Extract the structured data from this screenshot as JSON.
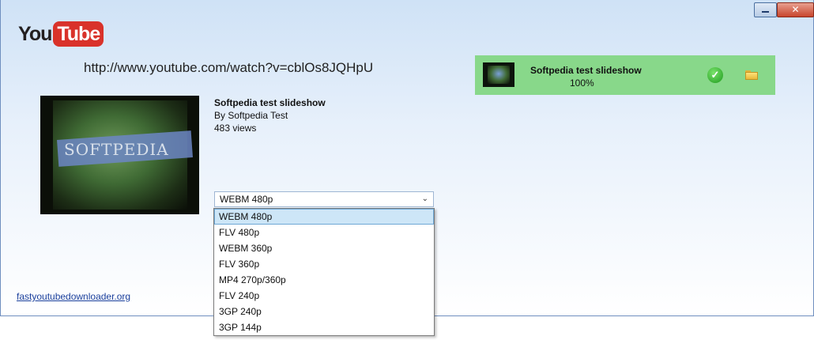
{
  "window": {
    "minimize_icon": "minimize-icon",
    "close_icon": "close-icon",
    "close_label": "✕"
  },
  "logo": {
    "you": "You",
    "tube": "Tube"
  },
  "url": "http://www.youtube.com/watch?v=cblOs8JQHpU",
  "video": {
    "title": "Softpedia test slideshow",
    "author": "By Softpedia Test",
    "views": "483 views",
    "thumbnail_text": "SOFTPEDIA"
  },
  "format_select": {
    "selected": "WEBM 480p",
    "options": [
      "WEBM 480p",
      "FLV 480p",
      "WEBM 360p",
      "FLV 360p",
      "MP4 270p/360p",
      "FLV 240p",
      "3GP 240p",
      "3GP 144p"
    ]
  },
  "footer_link": "fastyoutubedownloader.org",
  "download": {
    "title": "Softpedia test slideshow",
    "progress": "100%",
    "status_icon": "check-icon",
    "folder_icon": "folder-icon",
    "panel_color": "#88d88a"
  },
  "colors": {
    "youtube_red": "#d9322a",
    "link": "#1a3f9c"
  }
}
